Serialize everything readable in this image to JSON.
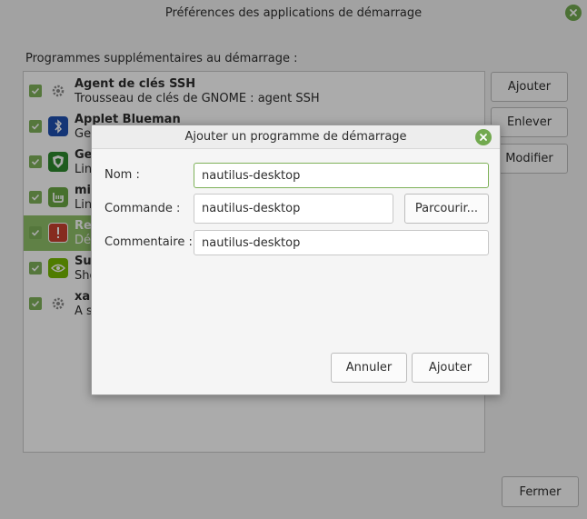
{
  "window": {
    "title": "Préférences des applications de démarrage",
    "section_label": "Programmes supplémentaires au démarrage :",
    "buttons": {
      "add": "Ajouter",
      "remove": "Enlever",
      "edit": "Modifier",
      "close": "Fermer"
    }
  },
  "startup_items": [
    {
      "title": "Agent de clés SSH",
      "description": "Trousseau de clés de GNOME : agent SSH",
      "checked": true,
      "icon": "gear-icon"
    },
    {
      "title": "Applet Blueman",
      "description": "Ges",
      "checked": true,
      "icon": "bluetooth-icon"
    },
    {
      "title": "Ge",
      "description": "Lin",
      "checked": true,
      "icon": "shield-icon"
    },
    {
      "title": "mi",
      "description": "Lin",
      "checked": true,
      "icon": "mint-logo-icon"
    },
    {
      "title": "Re",
      "description": "Dé",
      "checked": true,
      "icon": "warning-icon",
      "selected": true
    },
    {
      "title": "Sup",
      "description": "Sho",
      "checked": true,
      "icon": "nvidia-icon"
    },
    {
      "title": "xap",
      "description": "A s",
      "checked": true,
      "icon": "gear-icon"
    }
  ],
  "dialog": {
    "title": "Ajouter un programme de démarrage",
    "name_label": "Nom :",
    "name_value": "nautilus-desktop",
    "command_label": "Commande :",
    "command_value": "nautilus-desktop",
    "browse_label": "Parcourir...",
    "comment_label": "Commentaire :",
    "comment_value": "nautilus-desktop",
    "cancel_label": "Annuler",
    "add_label": "Ajouter"
  },
  "colors": {
    "accent": "#7fb25a",
    "selected_row": "#8fc069"
  }
}
